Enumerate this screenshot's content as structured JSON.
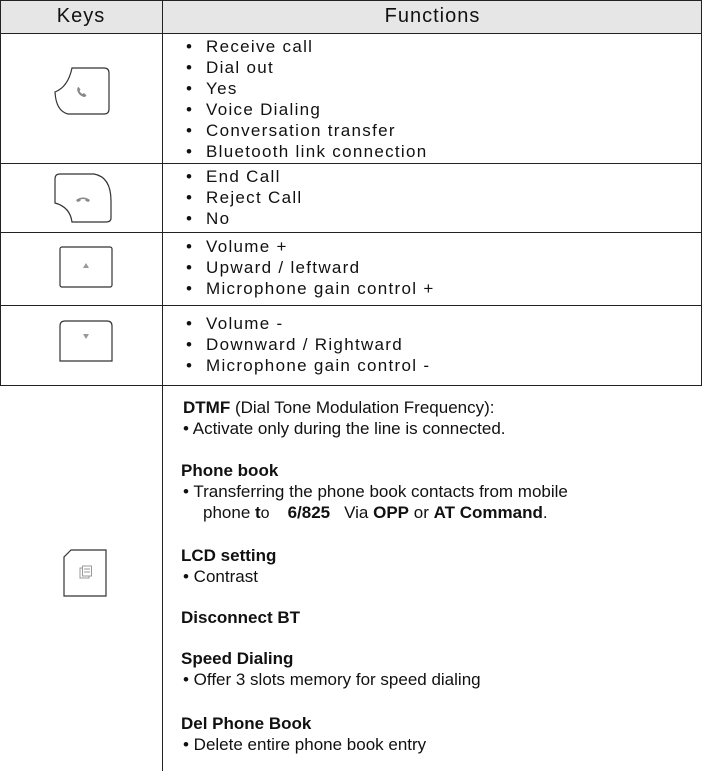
{
  "header": {
    "keys": "Keys",
    "functions": "Functions"
  },
  "rows": [
    {
      "key_icon": "call-key-icon",
      "items": [
        "Receive call",
        "Dial out",
        "Yes",
        "Voice Dialing",
        "Conversation transfer",
        "Bluetooth link connection"
      ]
    },
    {
      "key_icon": "end-call-key-icon",
      "items": [
        "End Call",
        "Reject Call",
        "No"
      ]
    },
    {
      "key_icon": "up-key-icon",
      "items": [
        "Volume +",
        "Upward / leftward",
        "Microphone gain control +"
      ]
    },
    {
      "key_icon": "down-key-icon",
      "items": [
        "Volume -",
        "Downward / Rightward",
        "Microphone gain control -"
      ]
    }
  ],
  "menu_row": {
    "key_icon": "menu-key-icon",
    "sections": [
      {
        "title": "DTMF",
        "title_suffix": " (Dial Tone Modulation Frequency):",
        "items": [
          "• Activate only during the line is connected."
        ]
      },
      {
        "title": "Phone book",
        "line1": "• Transferring the phone book contacts from mobile",
        "line2_a": "phone ",
        "line2_b": "t",
        "line2_c": "o",
        "line2_d": "6/825",
        "line2_e": "Via ",
        "line2_f": "OPP",
        "line2_g": " or ",
        "line2_h": "AT Command",
        "line2_i": "."
      },
      {
        "title": "LCD setting",
        "items": [
          "• Contrast"
        ]
      },
      {
        "title": "Disconnect BT",
        "items": []
      },
      {
        "title": "Speed Dialing",
        "items": [
          "• Offer 3 slots memory for speed dialing"
        ]
      },
      {
        "title": "Del Phone Book",
        "items": [
          "• Delete entire phone book entry"
        ]
      }
    ]
  }
}
